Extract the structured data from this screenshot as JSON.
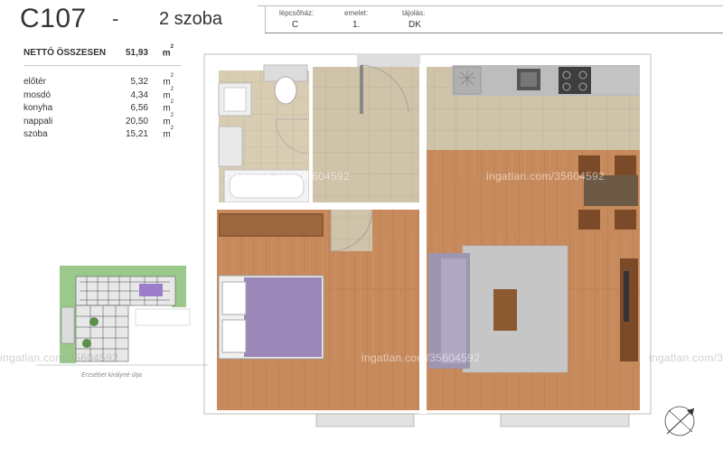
{
  "header": {
    "apartment_code": "C107",
    "dash": "-",
    "apartment_type": "2 szoba"
  },
  "meta": {
    "staircase_label": "lépcsőház:",
    "staircase_value": "C",
    "floor_label": "emelet:",
    "floor_value": "1.",
    "orientation_label": "tájolás:",
    "orientation_value": "DK"
  },
  "areas": {
    "total_label": "NETTÓ ÖSSZESEN",
    "total_value": "51,93",
    "unit": "m",
    "unit_exp": "2",
    "rooms": [
      {
        "name": "előtér",
        "value": "5,32"
      },
      {
        "name": "mosdó",
        "value": "4,34"
      },
      {
        "name": "konyha",
        "value": "6,56"
      },
      {
        "name": "nappali",
        "value": "20,50"
      },
      {
        "name": "szoba",
        "value": "15,21"
      }
    ]
  },
  "site_map": {
    "street_label": "Erzsébet királyné útja"
  },
  "watermark": {
    "text": "ingatlan.com/35604592"
  },
  "colors": {
    "wood_floor": "#c78a5c",
    "tile_floor": "#d4c7ad",
    "wall": "#ffffff",
    "bed": "#9a86b7",
    "sofa": "#9e95b0",
    "rug": "#c6c6c6"
  }
}
